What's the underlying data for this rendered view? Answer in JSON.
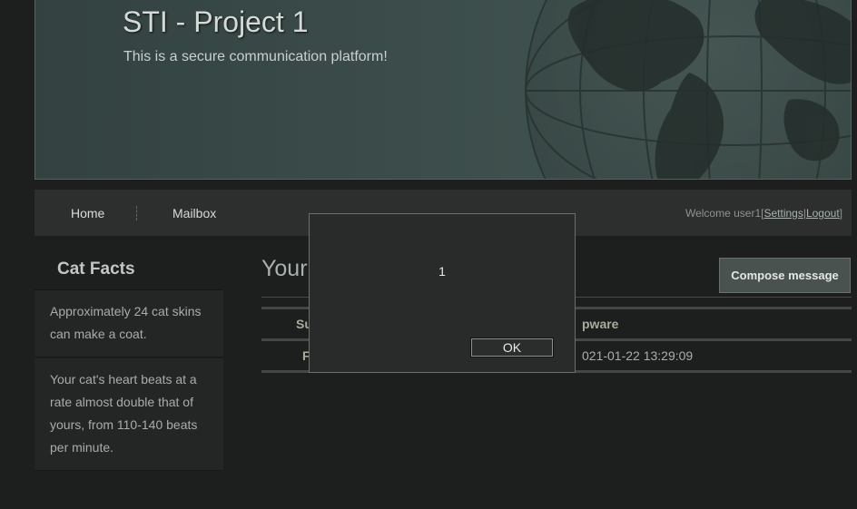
{
  "header": {
    "title": "STI - Project 1",
    "subtitle": "This is a secure communication platform!"
  },
  "nav": {
    "home_label": "Home",
    "mailbox_label": "Mailbox",
    "welcome_text": "Welcome user1",
    "settings_label": "Settings",
    "logout_label": "Logout"
  },
  "sidebar": {
    "title": "Cat Facts",
    "facts": [
      "Approximately 24 cat skins can make a coat.",
      "Your cat's heart beats at a rate almost double that of yours, from 110-140 beats per minute."
    ]
  },
  "main": {
    "title_visible": "Your",
    "compose_label": "Compose message",
    "table": {
      "header_cells": [
        "Su",
        "pware"
      ],
      "rows": [
        [
          "F",
          "021-01-22 13:29:09"
        ]
      ]
    }
  },
  "dialog": {
    "message": "1",
    "ok_label": "OK"
  }
}
